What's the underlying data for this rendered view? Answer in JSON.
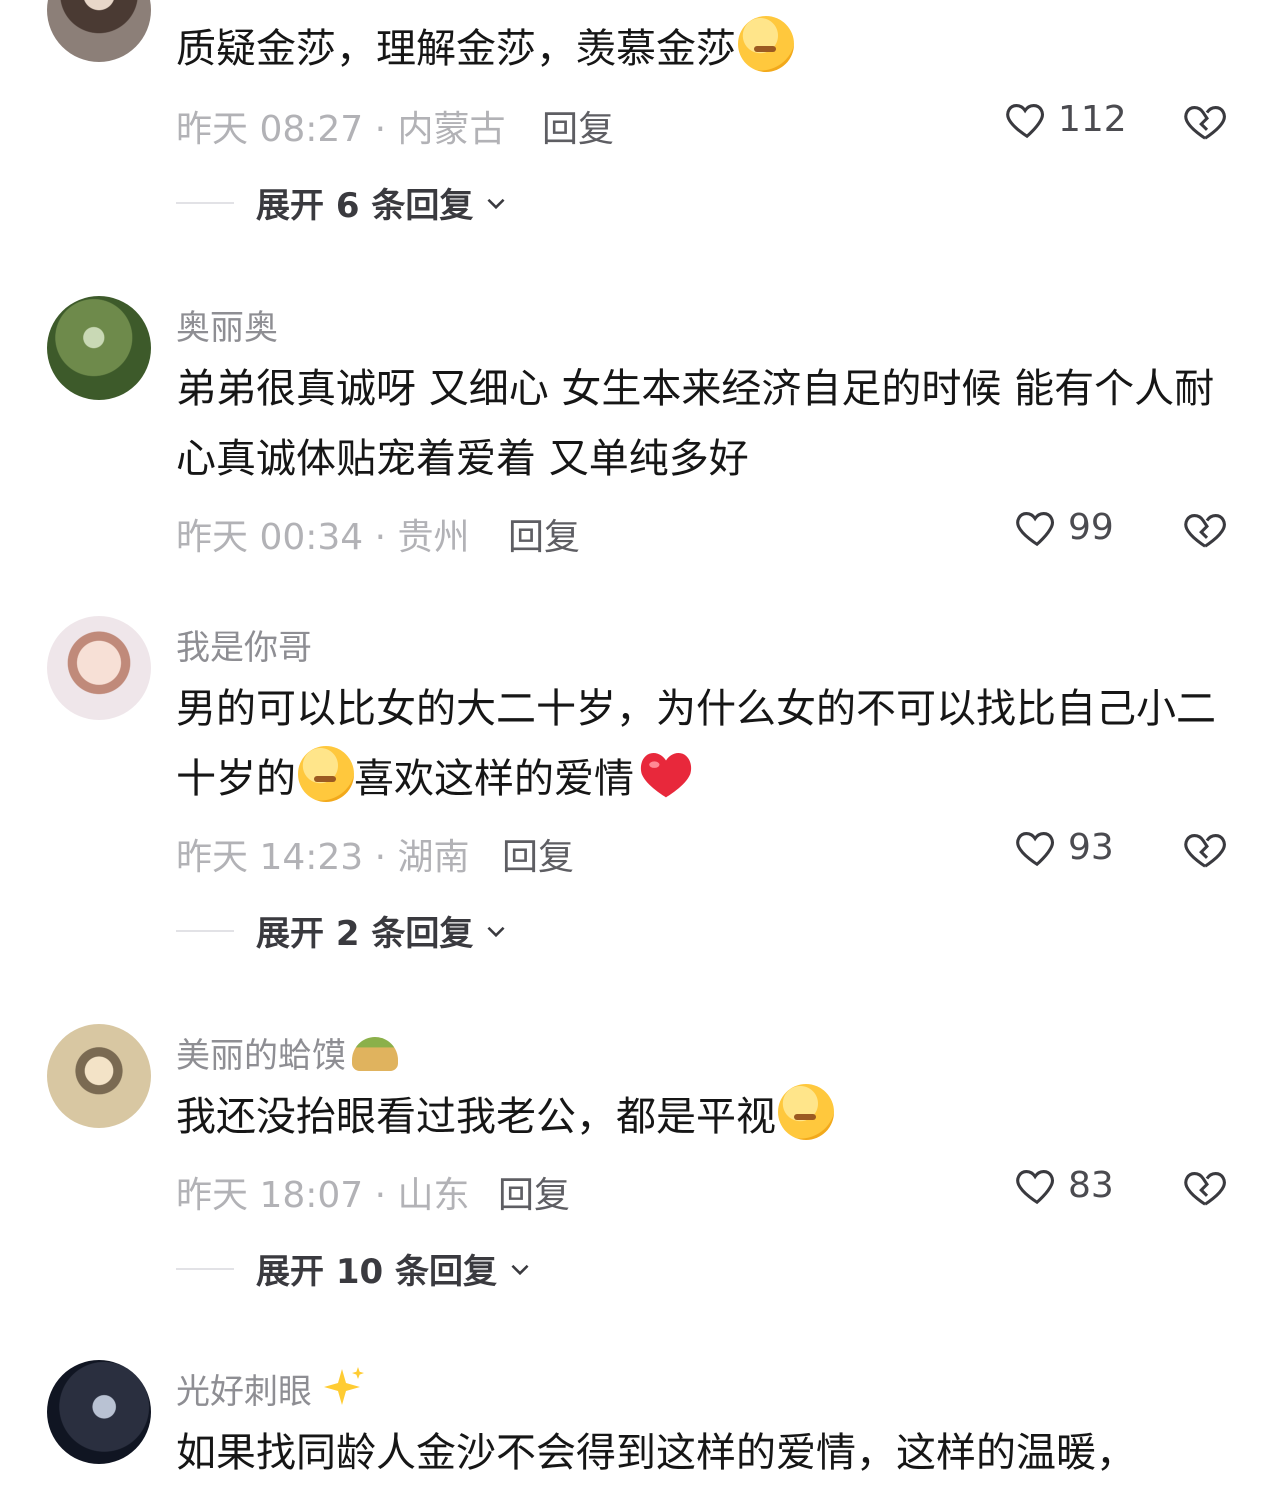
{
  "comments": [
    {
      "username": "",
      "text": "质疑金莎，理解金莎，羡慕金莎",
      "meta": "昨天 08:27 · 内蒙古",
      "reply": "回复",
      "likes": "112",
      "expand": "展开 6 条回复"
    },
    {
      "username": "奥丽奥",
      "text": "弟弟很真诚呀 又细心  女生本来经济自足的时候  能有个人耐心真诚体贴宠着爱着  又单纯多好",
      "meta": "昨天 00:34 · 贵州",
      "reply": "回复",
      "likes": "99"
    },
    {
      "username": "我是你哥",
      "text_a": "男的可以比女的大二十岁，为什么女的不可以找比自己小二十岁的",
      "text_b": "喜欢这样的爱情",
      "meta": "昨天 14:23 · 湖南",
      "reply": "回复",
      "likes": "93",
      "expand": "展开 2 条回复"
    },
    {
      "username": "美丽的蛤馍",
      "text": "我还没抬眼看过我老公，都是平视",
      "meta": "昨天 18:07 · 山东",
      "reply": "回复",
      "likes": "83",
      "expand": "展开 10 条回复"
    },
    {
      "username": "光好刺眼",
      "text": "如果找同龄人金沙不会得到这样的爱情，这样的温暖，"
    }
  ]
}
